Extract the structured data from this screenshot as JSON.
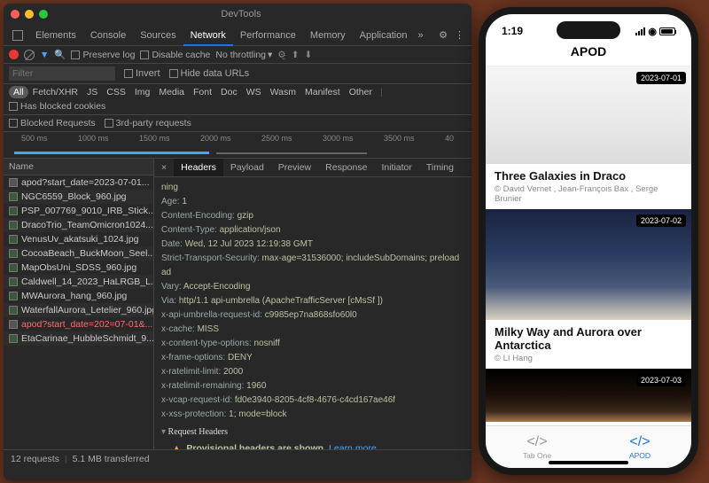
{
  "window": {
    "title": "DevTools"
  },
  "tabs": {
    "items": [
      "Elements",
      "Console",
      "Sources",
      "Network",
      "Performance",
      "Memory",
      "Application"
    ],
    "active": "Network"
  },
  "toolbar": {
    "preserve_log": "Preserve log",
    "disable_cache": "Disable cache",
    "throttling": "No throttling"
  },
  "filterrow": {
    "placeholder": "Filter",
    "invert": "Invert",
    "hide_data": "Hide data URLs"
  },
  "types": [
    "All",
    "Fetch/XHR",
    "JS",
    "CSS",
    "Img",
    "Media",
    "Font",
    "Doc",
    "WS",
    "Wasm",
    "Manifest",
    "Other"
  ],
  "types_active": "All",
  "has_blocked": "Has blocked cookies",
  "blocked_requests": "Blocked Requests",
  "third_party": "3rd-party requests",
  "timeline_ticks": [
    "500 ms",
    "1000 ms",
    "1500 ms",
    "2000 ms",
    "2500 ms",
    "3000 ms",
    "3500 ms",
    "40"
  ],
  "left": {
    "col": "Name",
    "requests": [
      {
        "name": "apod?start_date=2023-07-01...",
        "red": false,
        "img": false
      },
      {
        "name": "NGC6559_Block_960.jpg",
        "red": false,
        "img": true
      },
      {
        "name": "PSP_007769_9010_IRB_Stick...",
        "red": false,
        "img": true
      },
      {
        "name": "DracoTrio_TeamOmicron1024...",
        "red": false,
        "img": true
      },
      {
        "name": "VenusUv_akatsuki_1024.jpg",
        "red": false,
        "img": true
      },
      {
        "name": "CocoaBeach_BuckMoon_Seel...",
        "red": false,
        "img": true
      },
      {
        "name": "MapObsUni_SDSS_960.jpg",
        "red": false,
        "img": true
      },
      {
        "name": "Caldwell_14_2023_HaLRGB_L...",
        "red": false,
        "img": true
      },
      {
        "name": "MWAurora_hang_960.jpg",
        "red": false,
        "img": true
      },
      {
        "name": "WaterfallAurora_Letelier_960.jpg",
        "red": false,
        "img": true
      },
      {
        "name": "apod?start_date=202=07-01&...",
        "red": true,
        "img": false
      },
      {
        "name": "EtaCarinae_HubbleSchmidt_9...",
        "red": false,
        "img": true
      }
    ]
  },
  "detail_tabs": [
    "Headers",
    "Payload",
    "Preview",
    "Response",
    "Initiator",
    "Timing"
  ],
  "detail_active": "Headers",
  "headers": {
    "lines": [
      {
        "k": "",
        "v": "ning"
      },
      {
        "k": "Age:",
        "v": "1"
      },
      {
        "k": "Content-Encoding:",
        "v": "gzip"
      },
      {
        "k": "Content-Type:",
        "v": "application/json"
      },
      {
        "k": "Date:",
        "v": "Wed, 12 Jul 2023 12:19:38 GMT"
      },
      {
        "k": "Strict-Transport-Security:",
        "v": "max-age=31536000; includeSubDomains; preload"
      },
      {
        "k": "",
        "v": "ad"
      },
      {
        "k": "Vary:",
        "v": "Accept-Encoding"
      },
      {
        "k": "Via:",
        "v": "http/1.1 api-umbrella (ApacheTrafficServer [cMsSf ])"
      },
      {
        "k": "x-api-umbrella-request-id:",
        "v": "c9985ep7na868sfo60l0"
      },
      {
        "k": "x-cache:",
        "v": "MISS"
      },
      {
        "k": "x-content-type-options:",
        "v": "nosniff"
      },
      {
        "k": "x-frame-options:",
        "v": "DENY"
      },
      {
        "k": "x-ratelimit-limit:",
        "v": "2000"
      },
      {
        "k": "x-ratelimit-remaining:",
        "v": "1960"
      },
      {
        "k": "x-vcap-request-id:",
        "v": "fd0e3940-8205-4cf8-4676-c4cd167ae46f"
      },
      {
        "k": "x-xss-protection:",
        "v": "1; mode=block"
      }
    ],
    "request_section": "Request Headers",
    "provisional": "Provisional headers are shown",
    "learn_more": "Learn more"
  },
  "status": {
    "requests": "12 requests",
    "transferred": "5.1 MB transferred"
  },
  "phone": {
    "time": "1:19",
    "title": "APOD",
    "cards": [
      {
        "date": "2023-07-01",
        "title": "Three Galaxies in Draco",
        "author": "© David Vernet , Jean-François Bax , Serge Brunier"
      },
      {
        "date": "2023-07-02",
        "title": "Milky Way and Aurora over Antarctica",
        "author": "© LI Hang"
      },
      {
        "date": "2023-07-03",
        "title": "",
        "author": ""
      }
    ],
    "tabs": [
      {
        "label": "Tab One",
        "active": false
      },
      {
        "label": "APOD",
        "active": true
      }
    ]
  }
}
